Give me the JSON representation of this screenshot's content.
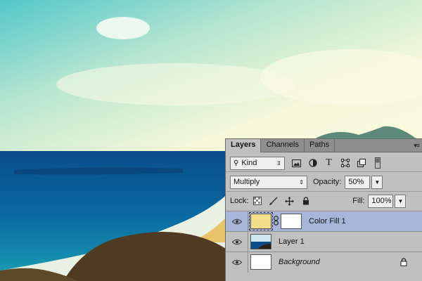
{
  "panel": {
    "tabs": [
      {
        "label": "Layers",
        "active": true
      },
      {
        "label": "Channels",
        "active": false
      },
      {
        "label": "Paths",
        "active": false
      }
    ],
    "filter": {
      "value": "Kind"
    },
    "blend_mode": {
      "value": "Multiply"
    },
    "opacity": {
      "label": "Opacity:",
      "value": "50%"
    },
    "lock": {
      "label": "Lock:"
    },
    "fill": {
      "label": "Fill:",
      "value": "100%"
    },
    "layers": [
      {
        "name": "Color Fill 1",
        "selected": true,
        "thumb_color": "#f3df8a",
        "mask": true
      },
      {
        "name": "Layer 1",
        "selected": false
      },
      {
        "name": "Background",
        "selected": false,
        "italic": true,
        "locked": true
      }
    ]
  },
  "colors": {
    "panel_bg": "#c0c0c0",
    "tab_bar": "#8f8f8f",
    "selection": "#a7b6d8"
  }
}
